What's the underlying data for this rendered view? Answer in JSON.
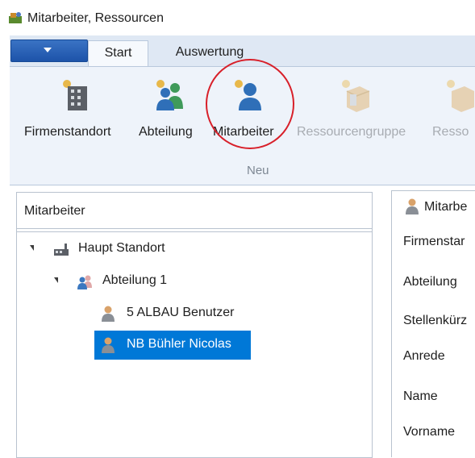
{
  "window": {
    "title": "Mitarbeiter, Ressourcen"
  },
  "ribbon": {
    "tabs": [
      {
        "label": "Start",
        "active": true
      },
      {
        "label": "Auswertung",
        "active": false
      }
    ],
    "buttons": [
      {
        "label": "Firmenstandort",
        "icon": "building-icon",
        "enabled": true
      },
      {
        "label": "Abteilung",
        "icon": "department-group-icon",
        "enabled": true
      },
      {
        "label": "Mitarbeiter",
        "icon": "employee-person-icon",
        "enabled": true,
        "highlighted": true
      },
      {
        "label": "Ressourcengruppe",
        "icon": "resource-group-icon",
        "enabled": false
      },
      {
        "label": "Resso",
        "icon": "resource-icon",
        "enabled": false
      }
    ],
    "group_label": "Neu"
  },
  "left_panel": {
    "title": "Mitarbeiter",
    "tree": [
      {
        "label": "Haupt Standort",
        "icon": "factory-icon",
        "level": 0,
        "expanded": true
      },
      {
        "label": "Abteilung 1",
        "icon": "department-group-icon",
        "level": 1,
        "expanded": true
      },
      {
        "label": "5 ALBAU Benutzer",
        "icon": "person-icon",
        "level": 2
      },
      {
        "label": "NB Bühler Nicolas",
        "icon": "person-icon",
        "level": 2,
        "selected": true
      }
    ]
  },
  "right_panel": {
    "header": "Mitarbe",
    "fields": [
      "Firmenstar",
      "Abteilung",
      "Stellenkürz",
      "Anrede",
      "Name",
      "Vorname"
    ]
  },
  "colors": {
    "accent": "#0078d7",
    "ribbon_bg": "#eef3fa",
    "tab_strip_bg": "#dfe8f4",
    "highlight_circle": "#d8202a"
  }
}
